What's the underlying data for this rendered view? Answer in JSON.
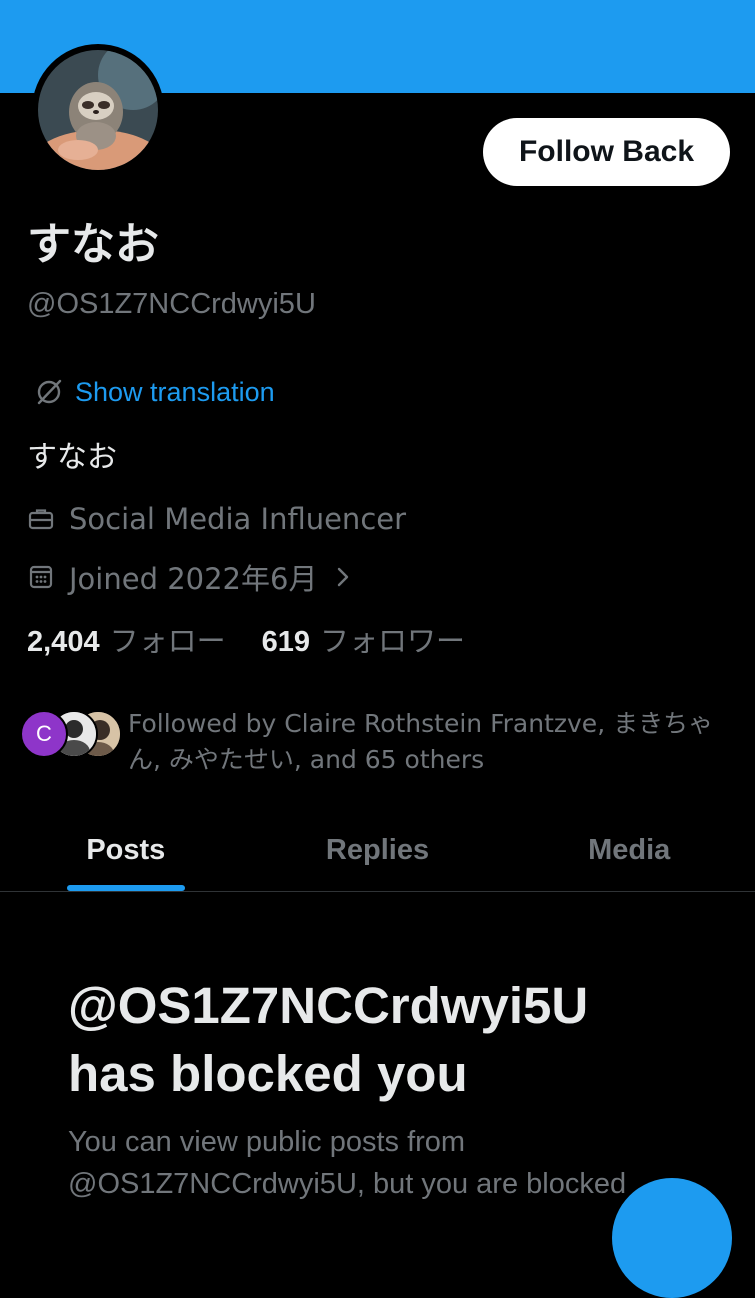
{
  "profile": {
    "display_name": "すなお",
    "handle": "@OS1Z7NCCrdwyi5U",
    "follow_button_label": "Follow Back",
    "translate_label": "Show translation",
    "bio": "すなお",
    "category": "Social Media Influencer",
    "joined": "Joined 2022年6月",
    "following_count": "2,404",
    "following_label": "フォロー",
    "followers_count": "619",
    "followers_label": "フォロワー"
  },
  "followed_by": {
    "first_avatar_initial": "C",
    "text": "Followed by Claire Rothstein Frantzve, まきちゃん, みやたせい, and 65 others"
  },
  "tabs": [
    {
      "label": "Posts",
      "active": true
    },
    {
      "label": "Replies",
      "active": false
    },
    {
      "label": "Media",
      "active": false
    }
  ],
  "blocked": {
    "title_handle": "@OS1Z7NCCrdwyi5U",
    "title_rest": "has blocked you",
    "description": "You can view public posts from @OS1Z7NCCrdwyi5U, but you are blocked"
  },
  "colors": {
    "accent": "#1d9bf0",
    "background": "#000000",
    "text_primary": "#e7e9ea",
    "text_secondary": "#71767b"
  },
  "icons": {
    "translate": "translate-globe-icon",
    "category": "briefcase-icon",
    "joined": "calendar-icon",
    "joined_chevron": "chevron-right-icon"
  }
}
